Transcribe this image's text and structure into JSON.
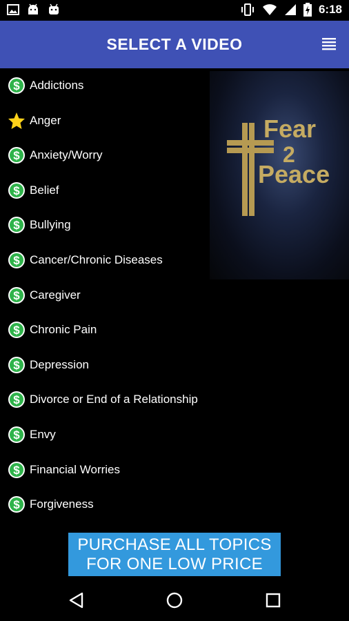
{
  "status_bar": {
    "time": "6:18",
    "left_icons": [
      "image-icon",
      "android-icon",
      "android-icon"
    ],
    "right_icons": [
      "vibrate-icon",
      "wifi-icon",
      "signal-icon",
      "battery-charging-icon"
    ]
  },
  "app_bar": {
    "title": "SELECT A VIDEO",
    "menu_icon": "menu-icon",
    "color": "#3F51B5"
  },
  "logo": {
    "line1": "Fear",
    "line2": "2",
    "line3": "Peace"
  },
  "topics": [
    {
      "label": "Addictions",
      "icon": "dollar-icon"
    },
    {
      "label": "Anger",
      "icon": "star-icon"
    },
    {
      "label": "Anxiety/Worry",
      "icon": "dollar-icon"
    },
    {
      "label": "Belief",
      "icon": "dollar-icon"
    },
    {
      "label": "Bullying",
      "icon": "dollar-icon"
    },
    {
      "label": "Cancer/Chronic Diseases",
      "icon": "dollar-icon"
    },
    {
      "label": "Caregiver",
      "icon": "dollar-icon"
    },
    {
      "label": "Chronic Pain",
      "icon": "dollar-icon"
    },
    {
      "label": "Depression",
      "icon": "dollar-icon"
    },
    {
      "label": "Divorce or End of a Relationship",
      "icon": "dollar-icon"
    },
    {
      "label": "Envy",
      "icon": "dollar-icon"
    },
    {
      "label": "Financial Worries",
      "icon": "dollar-icon"
    },
    {
      "label": "Forgiveness",
      "icon": "dollar-icon"
    }
  ],
  "purchase_button": {
    "line1": "PURCHASE ALL TOPICS",
    "line2": "FOR ONE LOW PRICE",
    "color": "#3399DD"
  },
  "nav_bar": {
    "buttons": [
      "back-icon",
      "home-icon",
      "recents-icon"
    ]
  }
}
